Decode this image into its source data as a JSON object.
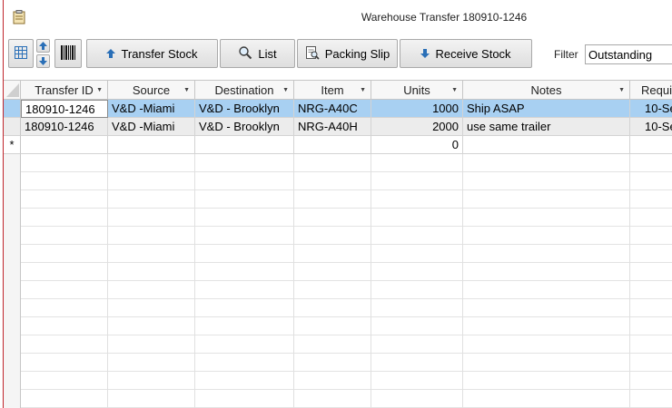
{
  "window": {
    "title": "Warehouse Transfer 180910-1246"
  },
  "toolbar": {
    "transfer_stock_label": "Transfer Stock",
    "list_label": "List",
    "packing_slip_label": "Packing Slip",
    "receive_stock_label": "Receive Stock",
    "filter_label": "Filter",
    "filter_value": "Outstanding"
  },
  "table": {
    "columns": [
      "Transfer ID",
      "Source",
      "Destination",
      "Item",
      "Units",
      "Notes",
      "Requi"
    ],
    "rows": [
      {
        "transfer_id": "180910-1246",
        "source": "V&D -Miami",
        "destination": "V&D - Brooklyn",
        "item": "NRG-A40C",
        "units": "1000",
        "notes": "Ship ASAP",
        "required": "10-Se"
      },
      {
        "transfer_id": "180910-1246",
        "source": "V&D -Miami",
        "destination": "V&D - Brooklyn",
        "item": "NRG-A40H",
        "units": "2000",
        "notes": "use same trailer",
        "required": "10-Se"
      }
    ],
    "new_row": {
      "marker": "*",
      "units": "0"
    }
  }
}
